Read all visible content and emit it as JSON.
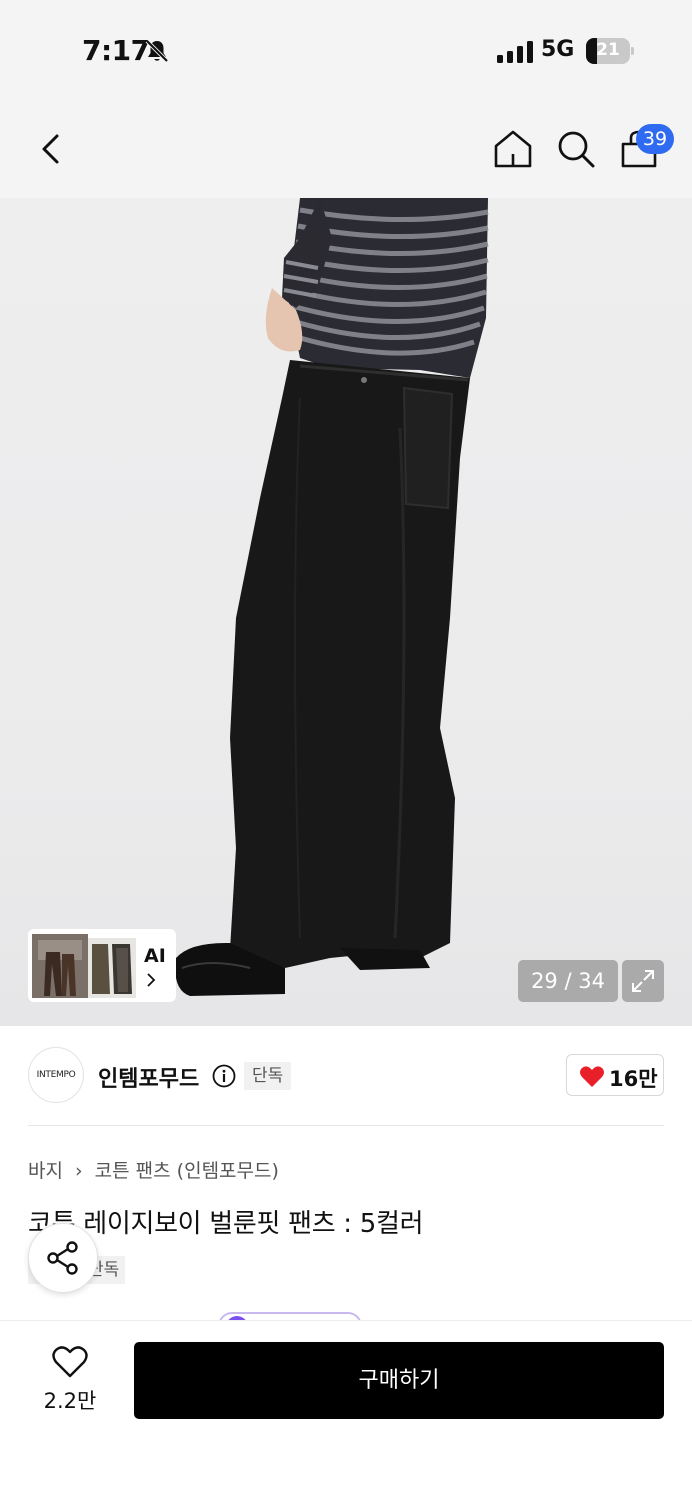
{
  "status_bar": {
    "time": "7:17",
    "network": "5G",
    "battery": "21",
    "icons": [
      "bell-slash-icon",
      "signal-icon",
      "battery-icon"
    ]
  },
  "nav": {
    "icons": [
      "back-arrow-icon",
      "home-icon",
      "search-icon",
      "cart-icon"
    ],
    "cart_badge": "39"
  },
  "gallery": {
    "counter": "29 / 34",
    "thumb_label": "AI",
    "icons": [
      "chevron-right-icon",
      "expand-icon"
    ]
  },
  "brand": {
    "logo_text": "INTEMPO",
    "name": "인템포무드",
    "exclusive_tag": "단독",
    "likes": "16만",
    "icons": [
      "info-icon",
      "heart-filled-icon"
    ]
  },
  "product": {
    "breadcrumb": [
      "바지",
      "코튼 팬츠 (인템포무드)"
    ],
    "title": "코튼 레이지보이 벌룬핏 팬츠 : 5컬러",
    "tag": "단독"
  },
  "bottom": {
    "wish_count": "2.2만",
    "buy_label": "구매하기",
    "icons": [
      "heart-outline-icon",
      "share-icon"
    ]
  },
  "colors": {
    "accent_blue": "#2f6bf0",
    "heart_red": "#e8202a",
    "buy_button": "#000000"
  }
}
